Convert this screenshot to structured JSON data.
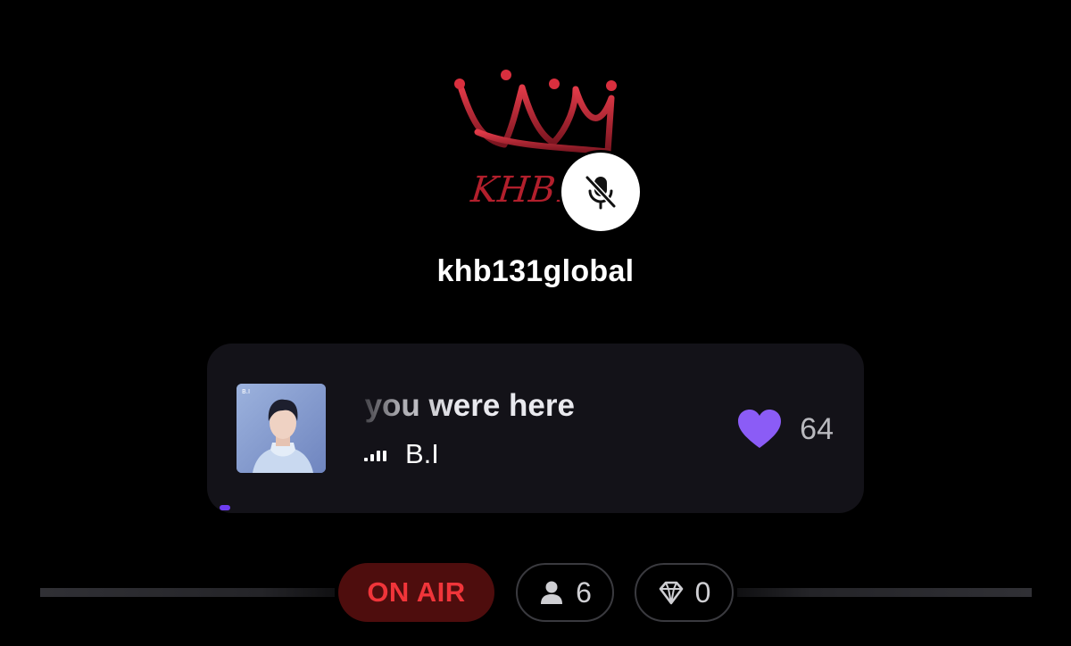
{
  "host": {
    "logo_text": "KHB13",
    "username": "khb131global",
    "mic_status": "muted",
    "mic_icon": "microphone-muted-icon"
  },
  "now_playing": {
    "title": "sh you were here",
    "artist": "B.I",
    "playing_icon": "equalizer-icon",
    "like_icon": "heart-icon",
    "like_count": "64",
    "like_color": "#8b5cf6"
  },
  "status_bar": {
    "on_air_label": "ON AIR",
    "on_air_bg": "#4e0d0d",
    "on_air_color": "#f0353a",
    "listeners_icon": "person-icon",
    "listeners_count": "6",
    "gems_icon": "diamond-icon",
    "gems_count": "0"
  }
}
